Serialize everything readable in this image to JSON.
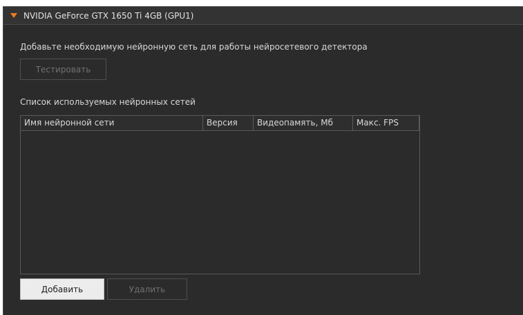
{
  "panel": {
    "title": "NVIDIA GeForce GTX 1650 Ti 4GB (GPU1)"
  },
  "main": {
    "info_text": "Добавьте необходимую нейронную сеть для работы нейросетевого детектора",
    "test_button": "Тестировать",
    "list_label": "Список используемых нейронных сетей",
    "table": {
      "columns": [
        "Имя нейронной сети",
        "Версия",
        "Видеопамять, Мб",
        "Макс. FPS"
      ],
      "rows": []
    },
    "add_button": "Добавить",
    "delete_button": "Удалить"
  },
  "colors": {
    "accent": "#f07a1e",
    "background": "#2b2b2b"
  },
  "icons": {
    "expand": "triangle-down-icon"
  }
}
